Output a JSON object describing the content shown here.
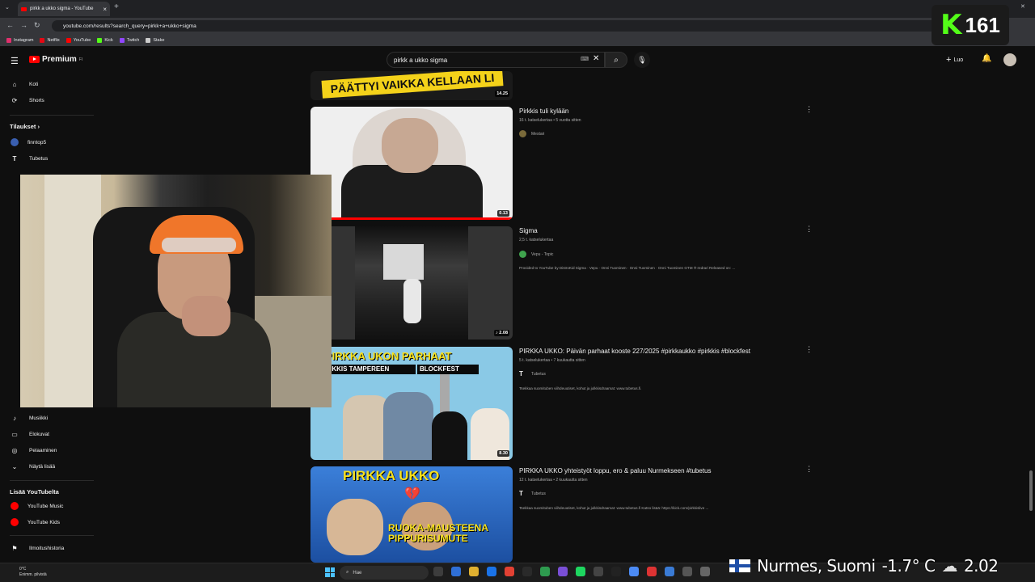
{
  "browser": {
    "tab_title": "pirkk a ukko sigma - YouTube",
    "url": "youtube.com/results?search_query=pirkk+a+ukko+sigma",
    "bookmarks": [
      {
        "label": "Instagram",
        "color": "#e1306c"
      },
      {
        "label": "Netflix",
        "color": "#e50914"
      },
      {
        "label": "YouTube",
        "color": "#ff0000"
      },
      {
        "label": "Kick",
        "color": "#53fc18"
      },
      {
        "label": "Twitch",
        "color": "#9146ff"
      },
      {
        "label": "Stake",
        "color": "#cccccc"
      }
    ]
  },
  "masthead": {
    "logo_text": "Premium",
    "logo_sup": "FI",
    "search_value": "pirkk a ukko sigma",
    "create_label": "Luo"
  },
  "kick_overlay": {
    "logo": "K",
    "viewers": "161"
  },
  "sidebar": {
    "items_top": [
      {
        "label": "Koti",
        "icon": "home-icon",
        "glyph": "⌂"
      },
      {
        "label": "Shorts",
        "icon": "shorts-icon",
        "glyph": "⟳"
      }
    ],
    "subs_header": "Tilaukset",
    "subs": [
      {
        "label": "finntop5",
        "color": "#3a5fb0"
      },
      {
        "label": "Tubetus",
        "color": "#333333"
      }
    ],
    "explore": [
      {
        "label": "Musiikki",
        "icon": "music-icon",
        "glyph": "♪"
      },
      {
        "label": "Elokuvat",
        "icon": "film-icon",
        "glyph": "▭"
      },
      {
        "label": "Pelaaminen",
        "icon": "gaming-icon",
        "glyph": "◎"
      },
      {
        "label": "Näytä lisää",
        "icon": "chevron-down-icon",
        "glyph": "⌄"
      }
    ],
    "more_header": "Lisää YouTubelta",
    "more": [
      {
        "label": "YouTube Music",
        "color": "#ff0000"
      },
      {
        "label": "YouTube Kids",
        "color": "#ff0000"
      }
    ],
    "bottom": [
      {
        "label": "Ilmoitushistoria",
        "icon": "flag-icon",
        "glyph": "⚑"
      }
    ]
  },
  "results": [
    {
      "thumb_text": "PÄÄTTYI VAIKKA KELLAAN LI",
      "duration": "14.25"
    },
    {
      "title": "Pirkkis tuli kylään",
      "meta": "16 t. katselukertaa • 5 vuotta sitten",
      "channel": "Mestari",
      "channel_color": "#7a6a3a",
      "duration": "0.13"
    },
    {
      "title": "Sigma",
      "meta": "2,5 t. katselukertaa",
      "channel": "Vepu - Topic",
      "channel_color": "#3fa34d",
      "desc": "Provided to YouTube by DistroKid Sigma · Vepu · Onni Tuominen · Onni Tuominen · Onni Tuominen GTM ℗ redrari Released on: ...",
      "duration": "♪ 2.08"
    },
    {
      "title": "PIRKKA UKKO: Päivän parhaat kooste 227/2025 #pirkkaukko #pirkkis #blockfest",
      "meta": "5 t. katselukertaa • 7 kuukautta sitten",
      "channel": "Tubetus",
      "channel_color": "#333333",
      "desc": "Tsekkaa suomituben viihdeuutiset, kohut ja julkkisdraamat: www.tubetus.fi.",
      "thumb_line1": "PIRKKA UKON PARHAAT",
      "thumb_line2": "PIRKKIS TAMPEREEN",
      "thumb_line3": "BLOCKFEST",
      "duration": "8.30"
    },
    {
      "title": "PIRKKA UKKO yhteistyöt loppu, ero & paluu Nurmekseen #tubetus",
      "meta": "12 t. katselukertaa • 2 kuukautta sitten",
      "channel": "Tubetus",
      "channel_color": "#333333",
      "desc": "Tsekkaa suomituben viihdeuutiset, kohut ja julkkisdraamat: www.tubetus.fi Katso lisää: https://kick.com/pirkkislive ...",
      "thumb_line1": "PIRKKA UKKO",
      "thumb_line2": "RUOKA-MAUSTEENA",
      "thumb_line3": "PIPPURISUMUTE"
    }
  ],
  "taskbar": {
    "weather_temp": "0°C",
    "weather_desc": "Enimm. pilvistä",
    "search_placeholder": "Hae",
    "icon_colors": [
      "#3d3d3d",
      "#2f6fd6",
      "#e0b030",
      "#1a73e8",
      "#e34133",
      "#2a2a2a",
      "#2e9b4f",
      "#7a4fd6",
      "#1ed760",
      "#444",
      "#222",
      "#4c8bf5",
      "#d33",
      "#3a7bd5",
      "#555",
      "#666"
    ]
  },
  "location_overlay": {
    "place": "Nurmes, Suomi",
    "temp": "-1.7° C",
    "time": "2.02"
  }
}
